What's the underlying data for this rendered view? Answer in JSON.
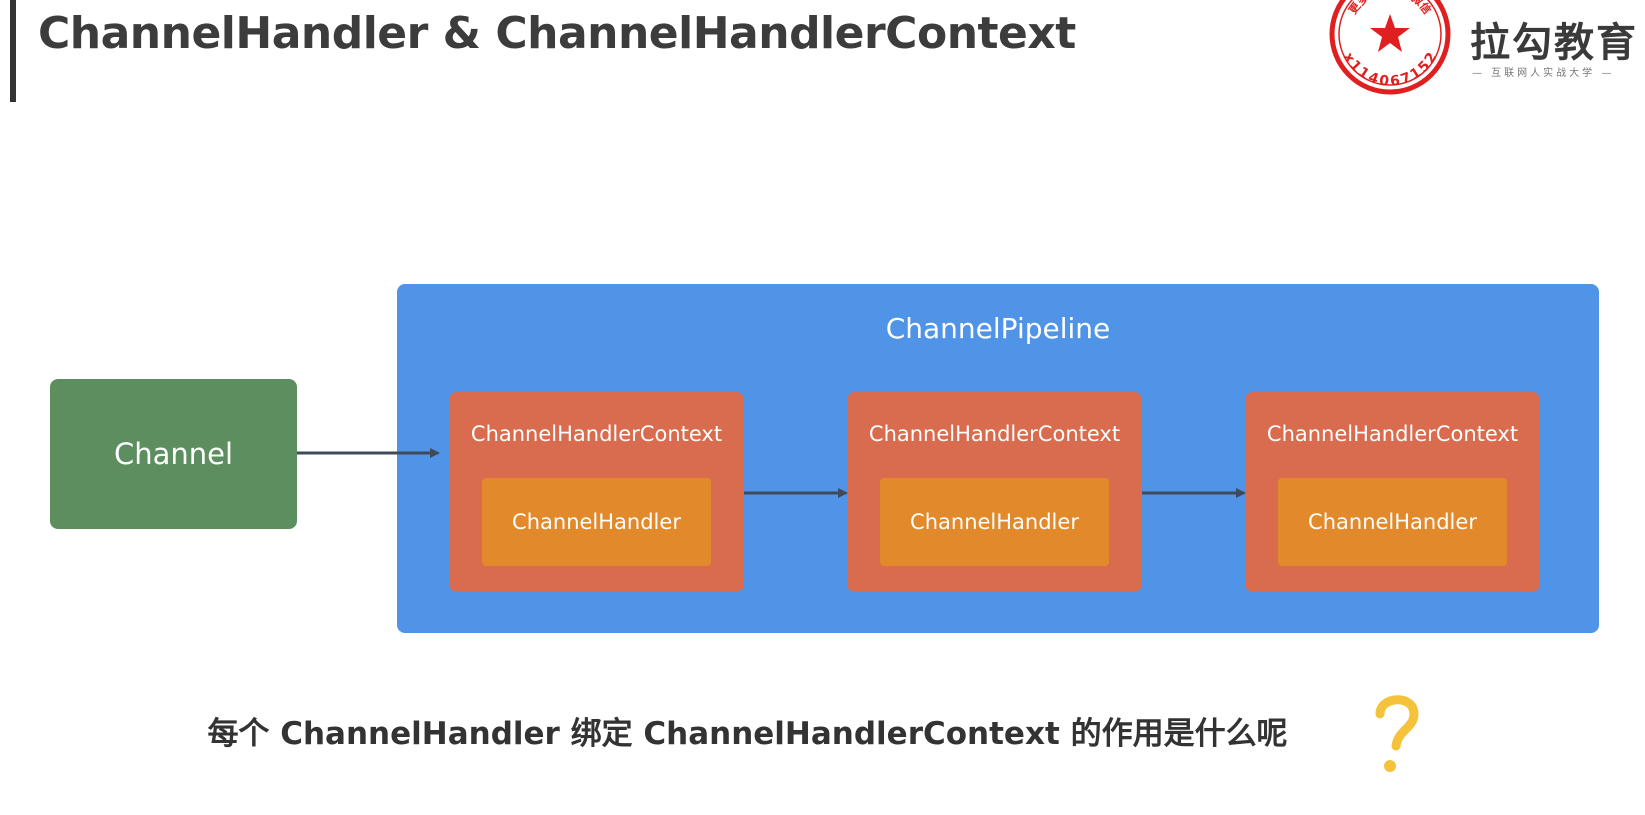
{
  "header": {
    "title": "ChannelHandler & ChannelHandlerContext"
  },
  "brand": {
    "name": "拉勾教育",
    "slogan": "— 互联网人实战大学 —",
    "seal_text_top": "更多资源请+微信",
    "seal_text_bottom": "x114067152"
  },
  "diagram": {
    "channel_label": "Channel",
    "pipeline_label": "ChannelPipeline",
    "contexts": [
      {
        "label": "ChannelHandlerContext",
        "handler": "ChannelHandler"
      },
      {
        "label": "ChannelHandlerContext",
        "handler": "ChannelHandler"
      },
      {
        "label": "ChannelHandlerContext",
        "handler": "ChannelHandler"
      }
    ]
  },
  "question": {
    "text": "每个 ChannelHandler 绑定 ChannelHandlerContext 的作用是什么呢"
  },
  "colors": {
    "channel": "#5d8e5f",
    "pipeline": "#4f94e6",
    "context": "#d96b4f",
    "handler": "#e2892b",
    "seal": "#e02020",
    "question_mark": "#f5c33b",
    "arrow": "#3f4a5c"
  },
  "icons": {
    "seal": "red-star-seal-icon",
    "question": "question-mark-icon"
  }
}
